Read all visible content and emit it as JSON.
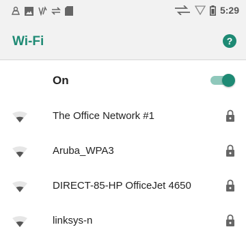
{
  "status_bar": {
    "left_icons": [
      "notification-icon",
      "image-icon",
      "signal-activity-icon",
      "sync-icon",
      "sd-card-icon"
    ],
    "right_icons": [
      "data-signal-icon",
      "wifi-outline-icon",
      "battery-icon"
    ],
    "time": "5:29"
  },
  "header": {
    "title": "Wi-Fi",
    "help_icon": "help-icon"
  },
  "wifi_toggle": {
    "label": "On",
    "state": true
  },
  "networks": [
    {
      "name": "The Office Network #1",
      "secured": true
    },
    {
      "name": "Aruba_WPA3",
      "secured": true
    },
    {
      "name": "DIRECT-85-HP OfficeJet 4650",
      "secured": true
    },
    {
      "name": "linksys-n",
      "secured": true
    }
  ],
  "colors": {
    "accent": "#1e8a74",
    "toggle_track": "#8fc8bb",
    "header_bg": "#f2f2f2",
    "icon_gray": "#666666"
  }
}
